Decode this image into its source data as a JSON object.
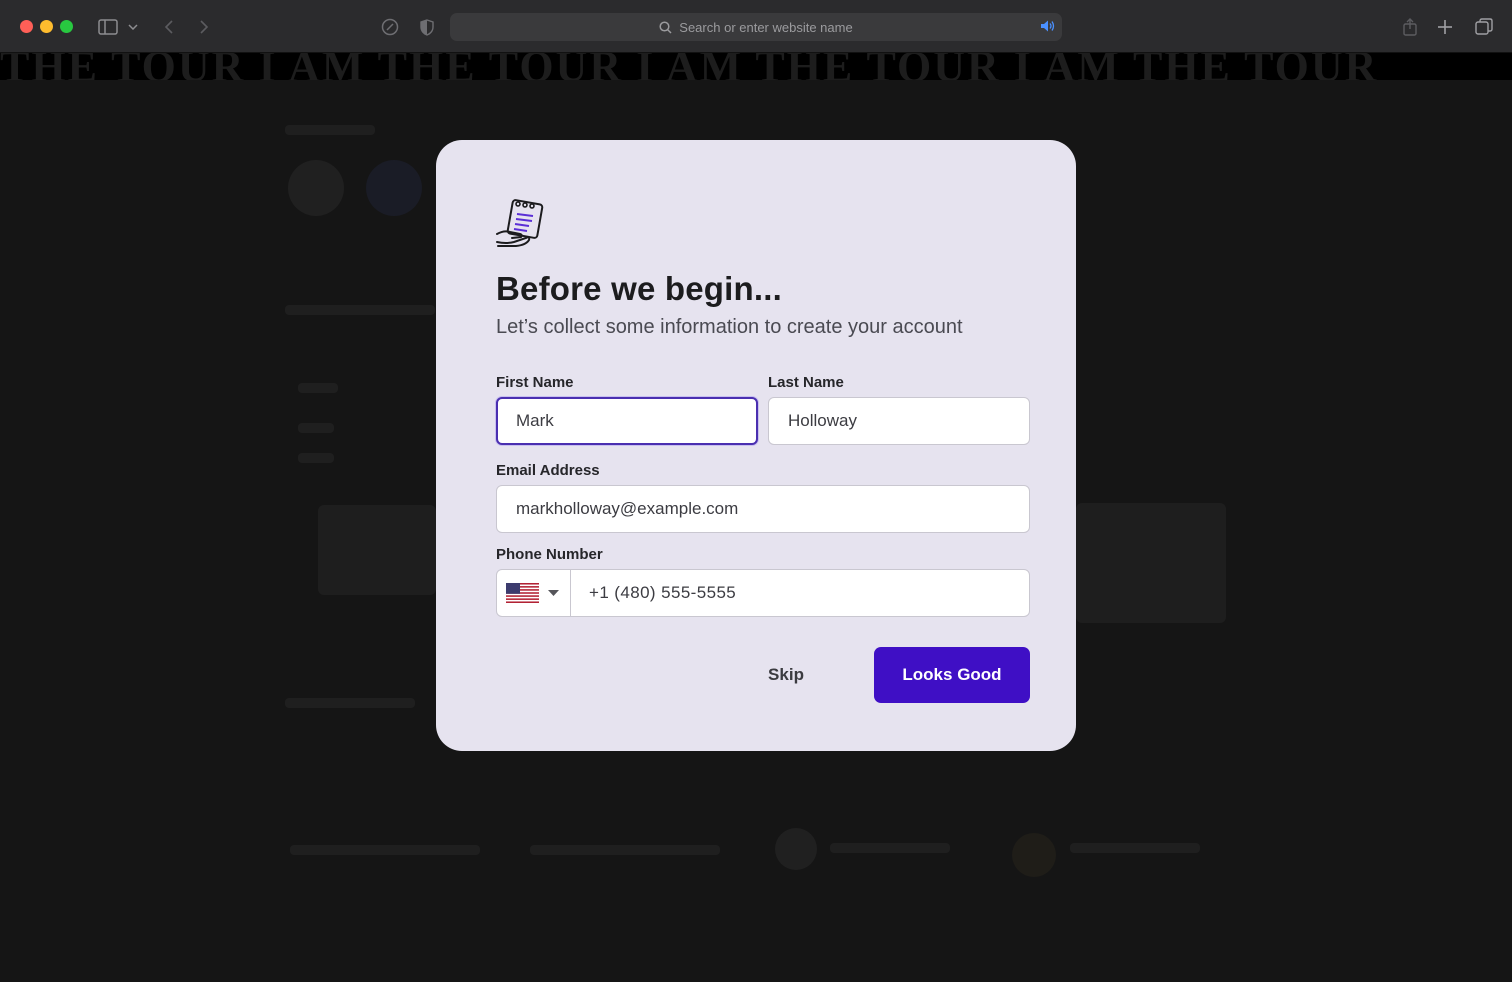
{
  "browser": {
    "url_placeholder": "Search or enter website name"
  },
  "background": {
    "banner_text": "THE TOUR I AM THE TOUR I AM THE TOUR I AM THE TOUR"
  },
  "modal": {
    "icon": "notepad-in-hand-icon",
    "title": "Before we begin...",
    "subtitle": "Let’s collect some information to create your account",
    "first_name": {
      "label": "First Name",
      "value": "Mark"
    },
    "last_name": {
      "label": "Last Name",
      "value": "Holloway"
    },
    "email": {
      "label": "Email Address",
      "value": "markholloway@example.com"
    },
    "phone": {
      "label": "Phone Number",
      "country_flag": "us-flag-icon",
      "value": "+1 (480) 555-5555"
    },
    "skip_label": "Skip",
    "submit_label": "Looks Good"
  },
  "colors": {
    "accent": "#3f0fc5",
    "modal_bg": "#e6e3ef"
  }
}
